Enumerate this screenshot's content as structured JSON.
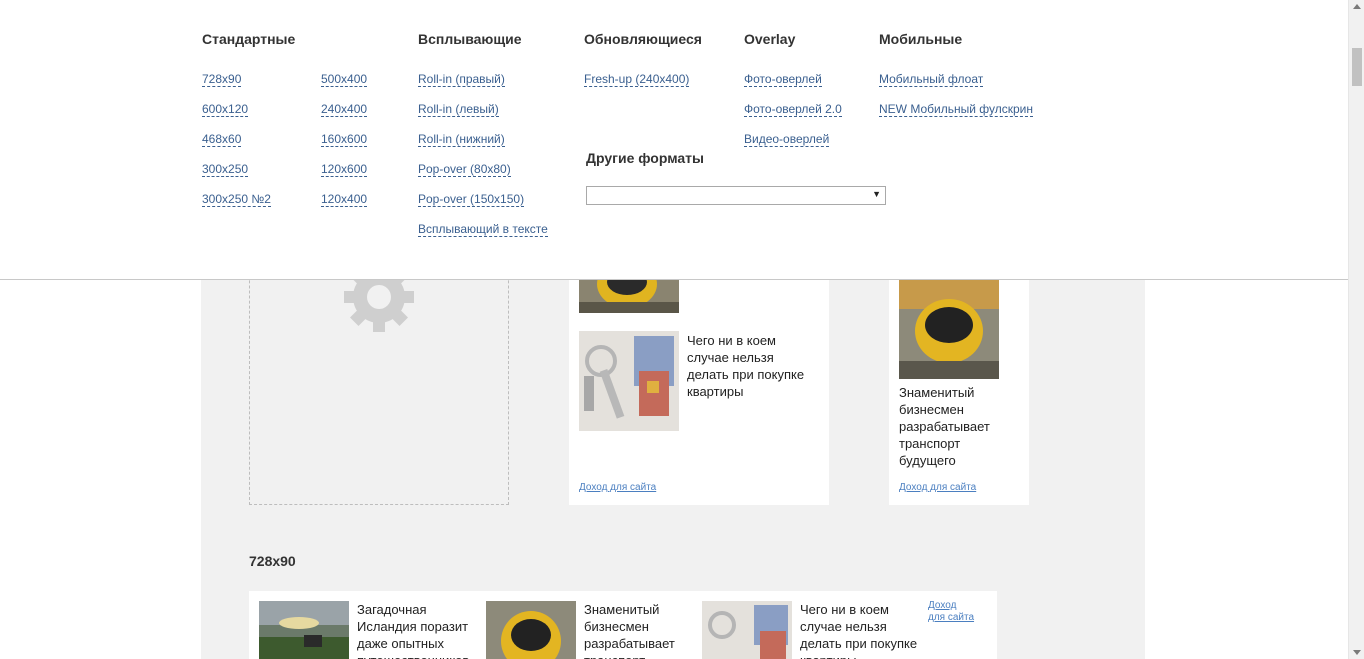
{
  "menu": {
    "col_standard": {
      "title": "Стандартные",
      "left_links": [
        "728x90",
        "600x120",
        "468x60",
        "300x250",
        "300x250 №2"
      ],
      "right_links": [
        "500x400",
        "240x400",
        "160x600",
        "120x600",
        "120x400"
      ]
    },
    "col_popup": {
      "title": "Всплывающие",
      "links": [
        "Roll-in (правый)",
        "Roll-in (левый)",
        "Roll-in (нижний)",
        "Pop-over (80x80)",
        "Pop-over (150x150)",
        "Всплывающий в тексте"
      ]
    },
    "col_updating": {
      "title": "Обновляющиеся",
      "links": [
        "Fresh-up (240x400)"
      ]
    },
    "col_overlay": {
      "title": "Overlay",
      "links": [
        "Фото-оверлей",
        "Фото-оверлей 2.0",
        "Видео-оверлей"
      ]
    },
    "col_mobile": {
      "title": "Мобильные",
      "links": [
        "Мобильный флоат",
        "NEW Мобильный фулскрин"
      ]
    },
    "other_formats": {
      "title": "Другие форматы",
      "selected": ""
    }
  },
  "content": {
    "ad1_text": "Чего ни в коем случае нельзя делать при покупке квартиры",
    "ad1_link": "Доход для сайта",
    "ad2_text": "Знаменитый бизнесмен разрабатывает транспорт будущего",
    "ad2_link": "Доход для сайта",
    "section_title": "728x90",
    "strip_items": [
      "Загадочная Исландия поразит даже опытных путешественников",
      "Знаменитый бизнесмен разрабатывает транспорт",
      "Чего ни в коем случае нельзя делать при покупке квартиры"
    ],
    "strip_link_line1": "Доход",
    "strip_link_line2": "для сайта"
  },
  "colors": {
    "link": "#3a5f8f",
    "ad_link": "#4b7fc0",
    "content_bg": "#f1f1f1"
  }
}
